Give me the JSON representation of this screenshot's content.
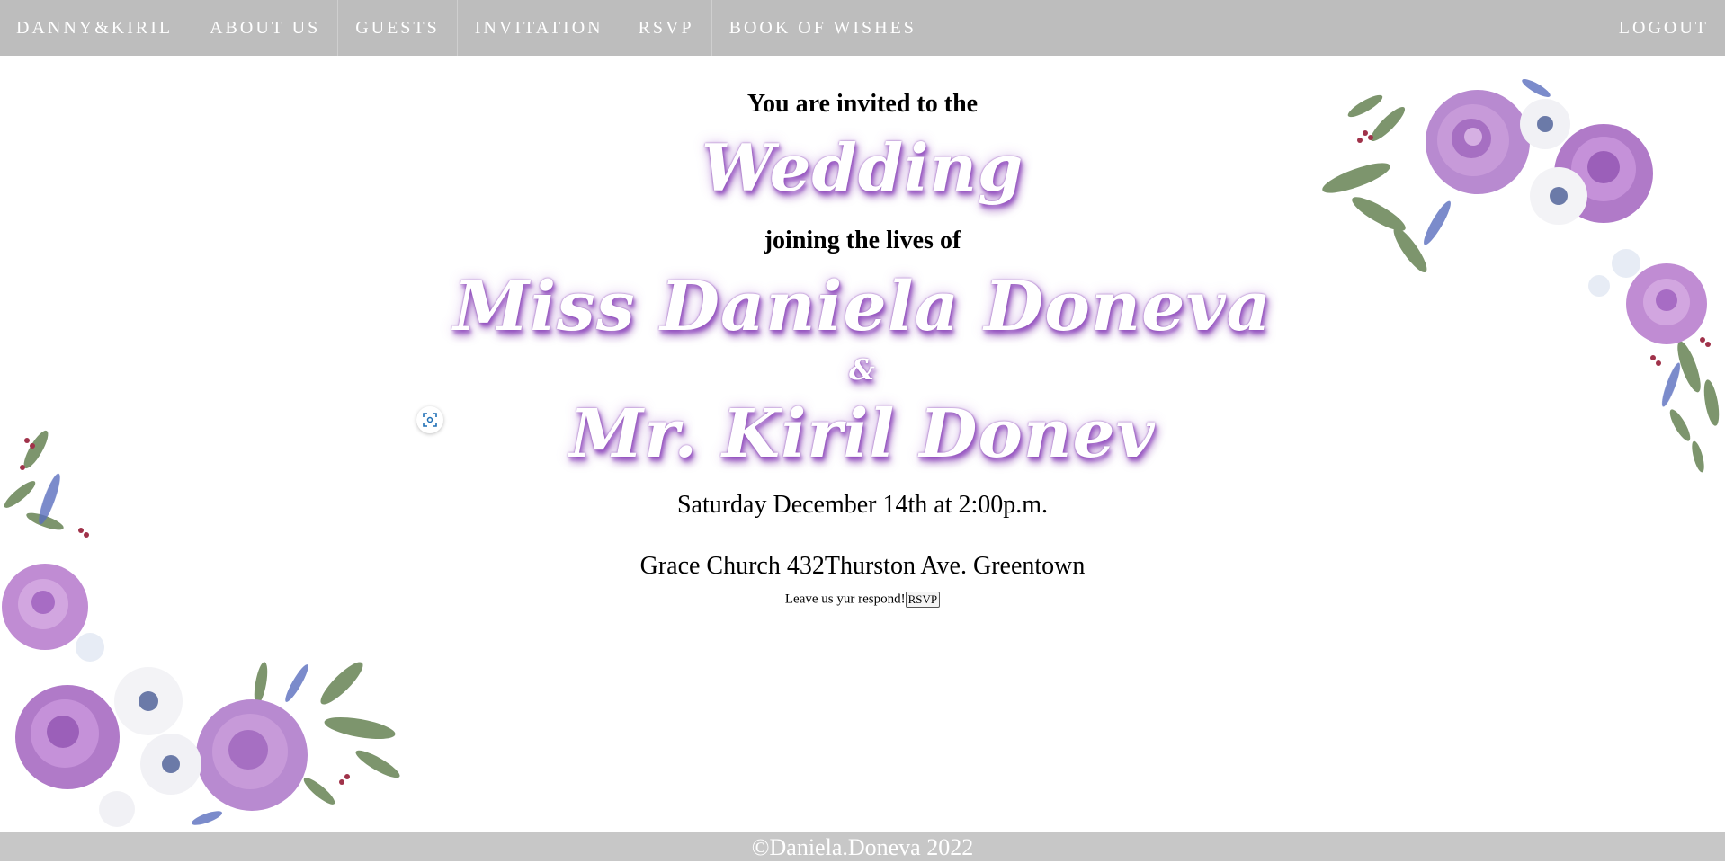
{
  "nav": {
    "brand": "DANNY&KIRIL",
    "items": [
      {
        "label": "ABOUT US"
      },
      {
        "label": "GUESTS"
      },
      {
        "label": "INVITATION"
      },
      {
        "label": "RSVP"
      },
      {
        "label": "BOOK OF WISHES"
      }
    ],
    "logout": "LOGOUT"
  },
  "invitation": {
    "intro": "You are invited to the",
    "event": "Wedding",
    "joining": "joining the lives of",
    "bride": "Miss Daniela Doneva",
    "ampersand": "&",
    "groom": "Mr. Kiril Donev",
    "date": "Saturday December 14th at 2:00p.m.",
    "venue": "Grace Church 432Thurston Ave. Greentown",
    "respond_text": "Leave us yur respond!",
    "rsvp_button": "RSVP"
  },
  "footer": {
    "copyright": "©Daniela.Doneva 2022"
  },
  "colors": {
    "navbar_bg": "#bdbdbd",
    "footer_bg": "#c7c7c7",
    "script_glow": "#9a5ac4",
    "rose": "#b07ac8",
    "leaf": "#5e7a4f"
  },
  "icons": [
    "screen-capture-icon"
  ]
}
